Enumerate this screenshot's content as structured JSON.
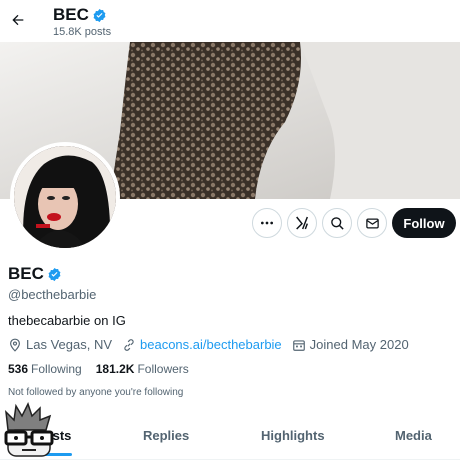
{
  "header": {
    "back_label": "Back",
    "name": "BEC",
    "posts_count": "15.8K posts"
  },
  "profile": {
    "name": "BEC",
    "handle": "@becthebarbie",
    "bio": "thebecabarbie on IG",
    "location": "Las Vegas, NV",
    "website": "beacons.ai/becthebarbie",
    "joined": "Joined May 2020",
    "following_count": "536",
    "following_label": "Following",
    "followers_count": "181.2K",
    "followers_label": "Followers",
    "not_followed_text": "Not followed by anyone you're following"
  },
  "actions": {
    "more_icon": "more-icon",
    "grok_icon": "grok-icon",
    "search_icon": "search-icon",
    "message_icon": "mail-icon",
    "follow_label": "Follow"
  },
  "tabs": [
    {
      "label": "Posts"
    },
    {
      "label": "Replies"
    },
    {
      "label": "Highlights"
    },
    {
      "label": "Media"
    }
  ],
  "colors": {
    "accent": "#1d9bf0",
    "text": "#0f1419",
    "muted": "#536471",
    "follow_bg": "#0f1419"
  }
}
